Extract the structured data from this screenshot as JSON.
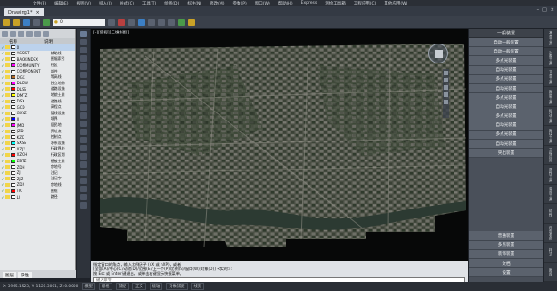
{
  "menu": [
    "文件(F)",
    "编辑(E)",
    "视图(V)",
    "插入(I)",
    "格式(O)",
    "工具(T)",
    "绘图(D)",
    "标注(N)",
    "修改(M)",
    "参数(P)",
    "窗口(W)",
    "帮助(H)",
    "Express",
    "测绘工具箱",
    "工程应用(C)",
    "其他应用(W)"
  ],
  "doc_tab": "Drawing1*",
  "layer_combo": "0",
  "layer_panel": {
    "header": {
      "name": "名称",
      "desc": "说明"
    },
    "rows": [
      {
        "name": "0",
        "desc": "",
        "color": "#ffffff"
      },
      {
        "name": "ASSIST",
        "desc": "辅助线",
        "color": "#ffffff"
      },
      {
        "name": "BACKINDEX",
        "desc": "图幅索引",
        "color": "#ffffff"
      },
      {
        "name": "COMMUNITY",
        "desc": "社区",
        "color": "#ff00ff"
      },
      {
        "name": "COMPONENT",
        "desc": "部件",
        "color": "#ffffff"
      },
      {
        "name": "DGX",
        "desc": "等高线",
        "color": "#b46a2a"
      },
      {
        "name": "DLDW",
        "desc": "独立地物",
        "color": "#ff00ff"
      },
      {
        "name": "DLSS",
        "desc": "道路设施",
        "color": "#ff0000"
      },
      {
        "name": "DMTZ",
        "desc": "地貌土质",
        "color": "#ffff00"
      },
      {
        "name": "DSX",
        "desc": "道路线",
        "color": "#ffffff"
      },
      {
        "name": "GCD",
        "desc": "高程点",
        "color": "#ffffff"
      },
      {
        "name": "GXYZ",
        "desc": "管线设施",
        "color": "#ffffff"
      },
      {
        "name": "JJ",
        "desc": "境界",
        "color": "#0000ff"
      },
      {
        "name": "JMD",
        "desc": "居民地",
        "color": "#ff00ff"
      },
      {
        "name": "JZD",
        "desc": "界址点",
        "color": "#ffffff"
      },
      {
        "name": "KZD",
        "desc": "控制点",
        "color": "#ffffff"
      },
      {
        "name": "SXSS",
        "desc": "水系设施",
        "color": "#00ffff"
      },
      {
        "name": "XZJX",
        "desc": "行政界线",
        "color": "#ffffff"
      },
      {
        "name": "XZQH",
        "desc": "行政区划",
        "color": "#ff0000"
      },
      {
        "name": "ZBTZ",
        "desc": "植被土质",
        "color": "#00ff00"
      },
      {
        "name": "ZDH",
        "desc": "宗地号",
        "color": "#ffffff"
      },
      {
        "name": "ZJ",
        "desc": "注记",
        "color": "#ffffff"
      },
      {
        "name": "ZJZ",
        "desc": "注记字",
        "color": "#ffffff"
      },
      {
        "name": "ZDX",
        "desc": "宗地线",
        "color": "#ffffff"
      },
      {
        "name": "TK",
        "desc": "图框",
        "color": "#ff0000"
      },
      {
        "name": "LJ",
        "desc": "路径",
        "color": "#ffffff"
      }
    ],
    "tabs": [
      "图层",
      "属性"
    ]
  },
  "view_label": "[-][俯视][二维线框]",
  "command": {
    "lines": [
      "指定窗口的角点，输入比例因子 (nX 或 nXP)，或者",
      "[全部(A)/中心(C)/动态(D)/范围(E)/上一个(P)/比例(S)/窗口(W)/对象(O)] <实时>:",
      "按 Esc 或 Enter 键退出，或单击右键显示快捷菜单。"
    ],
    "prompt": "键入命令"
  },
  "right_panel": {
    "title": "一般装置",
    "buttons": [
      "自动一般装置",
      "自动一般装置",
      "多点光装置",
      "自动光装置",
      "多点光装置",
      "自动光装置",
      "多点光装置",
      "自动光装置",
      "多点光装置",
      "自动光装置",
      "多点光装置",
      "自动光装置",
      "突出装置"
    ],
    "bottom_buttons": [
      "普通装置",
      "多点装置",
      "装饰装置",
      "文档",
      "设置"
    ]
  },
  "vertical_tabs": [
    "基本工具",
    "对象工具",
    "文本工具",
    "图层工具",
    "标注工具",
    "图块工具",
    "工程应用",
    "属性工具",
    "查询工具",
    "特性",
    "外部参照",
    "样式",
    "图库"
  ],
  "status": [
    "X: 3965.1523, Y: 1126.3001, Z: 0.0000",
    "模型",
    "栅格",
    "捕捉",
    "正交",
    "极轴",
    "对象捕捉",
    "线宽"
  ]
}
